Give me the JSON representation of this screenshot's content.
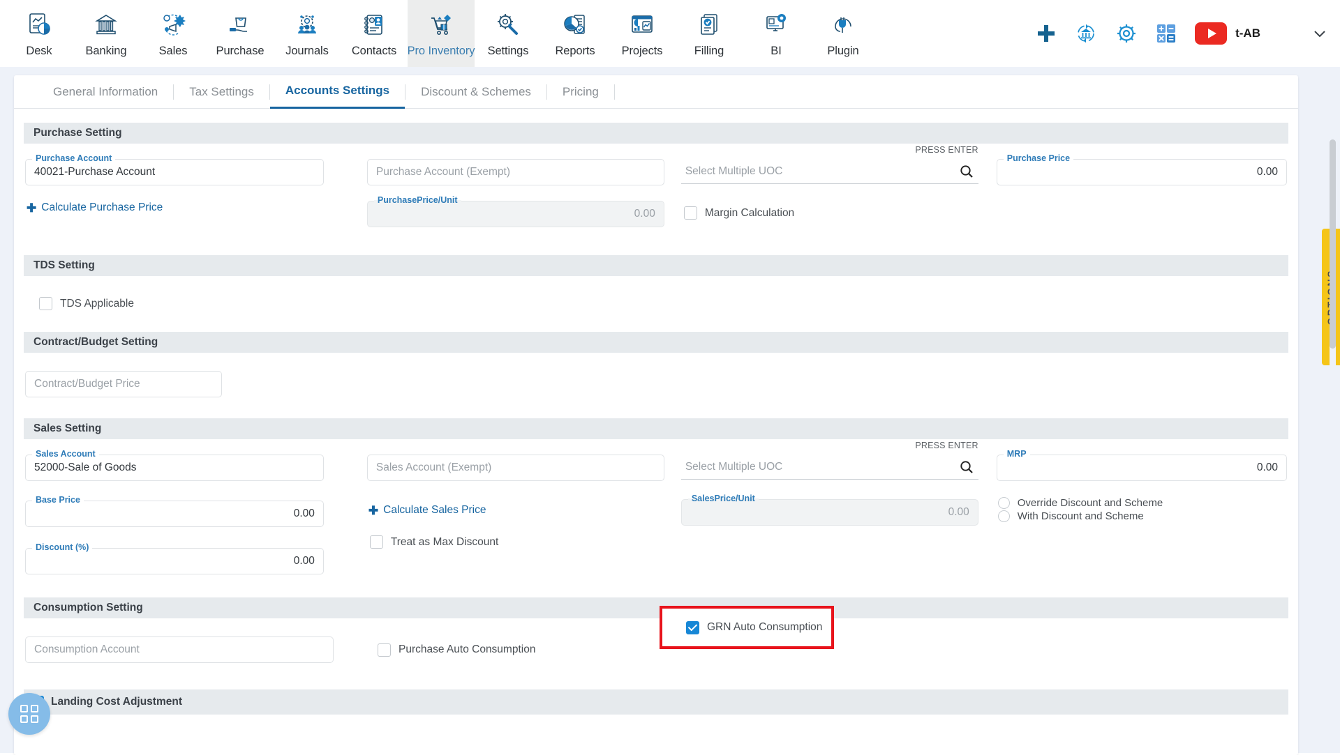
{
  "topnav": {
    "items": [
      {
        "label": "Desk",
        "icon": "dashboard-report-icon",
        "active": false
      },
      {
        "label": "Banking",
        "icon": "bank-building-icon",
        "active": false
      },
      {
        "label": "Sales",
        "icon": "sales-megaphone-icon",
        "active": false
      },
      {
        "label": "Purchase",
        "icon": "purchase-bag-hand-icon",
        "active": false
      },
      {
        "label": "Journals",
        "icon": "journals-gear-people-icon",
        "active": false
      },
      {
        "label": "Contacts",
        "icon": "contacts-book-icon",
        "active": false
      },
      {
        "label": "Pro Inventory",
        "icon": "inventory-cart-icon",
        "active": true
      },
      {
        "label": "Settings",
        "icon": "settings-gear-wrench-icon",
        "active": false
      },
      {
        "label": "Reports",
        "icon": "reports-piechart-icon",
        "active": false
      },
      {
        "label": "Projects",
        "icon": "projects-dashboard-icon",
        "active": false
      },
      {
        "label": "Filling",
        "icon": "filling-documents-check-icon",
        "active": false
      },
      {
        "label": "BI",
        "icon": "bi-monitor-gear-icon",
        "active": false
      },
      {
        "label": "Plugin",
        "icon": "plugin-plug-icon",
        "active": false
      }
    ],
    "actions": [
      {
        "name": "add-new-icon",
        "glyph": "+"
      },
      {
        "name": "refresh-bank-icon",
        "glyph": "sync"
      },
      {
        "name": "gear-icon",
        "glyph": "gear"
      },
      {
        "name": "calculator-icon",
        "glyph": "calc"
      },
      {
        "name": "youtube-icon",
        "glyph": "play"
      }
    ],
    "user_label": "t-AB",
    "chevron": "chevron-down-icon"
  },
  "tabs": [
    {
      "label": "General Information",
      "active": false
    },
    {
      "label": "Tax Settings",
      "active": false
    },
    {
      "label": "Accounts Settings",
      "active": true
    },
    {
      "label": "Discount & Schemes",
      "active": false
    },
    {
      "label": "Pricing",
      "active": false
    }
  ],
  "options_tab_label": "OPTIONS",
  "purchase_setting": {
    "title": "Purchase Setting",
    "purchase_account": {
      "label": "Purchase Account",
      "value": "40021-Purchase Account"
    },
    "purchase_account_exempt": {
      "placeholder": "Purchase Account (Exempt)",
      "value": ""
    },
    "uoc": {
      "placeholder": "Select Multiple UOC",
      "hint": "PRESS ENTER",
      "icon": "search-icon"
    },
    "purchase_price": {
      "label": "Purchase Price",
      "value": "0.00"
    },
    "calculate_purchase_price": "Calculate Purchase Price",
    "purchase_price_unit": {
      "label": "PurchasePrice/Unit",
      "value": "0.00",
      "disabled": true
    },
    "margin_calculation": {
      "label": "Margin Calculation",
      "checked": false
    }
  },
  "tds_setting": {
    "title": "TDS Setting",
    "tds_applicable": {
      "label": "TDS Applicable",
      "checked": false
    }
  },
  "contract_budget_setting": {
    "title": "Contract/Budget Setting",
    "contract_budget_price": {
      "placeholder": "Contract/Budget Price",
      "value": ""
    }
  },
  "sales_setting": {
    "title": "Sales Setting",
    "sales_account": {
      "label": "Sales Account",
      "value": "52000-Sale of Goods"
    },
    "sales_account_exempt": {
      "placeholder": "Sales Account (Exempt)",
      "value": ""
    },
    "uoc": {
      "placeholder": "Select Multiple UOC",
      "hint": "PRESS ENTER",
      "icon": "search-icon"
    },
    "mrp": {
      "label": "MRP",
      "value": "0.00"
    },
    "base_price": {
      "label": "Base Price",
      "value": "0.00"
    },
    "calculate_sales_price": "Calculate Sales Price",
    "sales_price_unit": {
      "label": "SalesPrice/Unit",
      "value": "0.00",
      "disabled": true
    },
    "discount_options": [
      {
        "label": "Override Discount and Scheme",
        "selected": false
      },
      {
        "label": "With Discount and Scheme",
        "selected": false
      }
    ],
    "discount_pct": {
      "label": "Discount (%)",
      "value": "0.00"
    },
    "treat_as_max_discount": {
      "label": "Treat as Max Discount",
      "checked": false
    }
  },
  "consumption_setting": {
    "title": "Consumption Setting",
    "consumption_account": {
      "placeholder": "Consumption Account",
      "value": ""
    },
    "purchase_auto_consumption": {
      "label": "Purchase Auto Consumption",
      "checked": false
    },
    "grn_auto_consumption": {
      "label": "GRN Auto Consumption",
      "checked": true,
      "highlighted": true
    }
  },
  "landing_cost": {
    "label": "Landing Cost Adjustment",
    "checked": true
  },
  "fab": {
    "name": "apps-grid-button"
  },
  "colors": {
    "accent": "#1765a0",
    "checkbox_checked": "#1787d6",
    "section_header_bg": "#e6eaed",
    "page_bg": "#eef2f9",
    "highlight": "#e8141c",
    "options_tab": "#f5c518",
    "youtube_red": "#eb2a22"
  }
}
